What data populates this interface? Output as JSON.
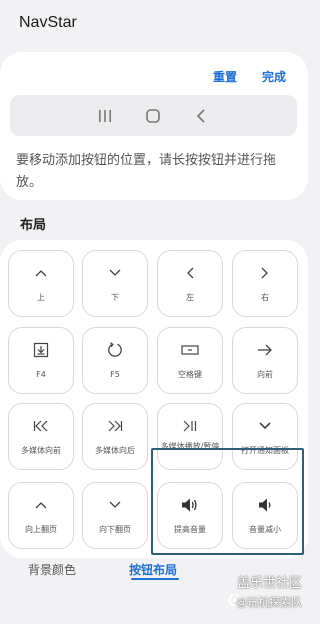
{
  "app_title": "NavStar",
  "header_actions": {
    "reset_label": "重置",
    "done_label": "完成"
  },
  "nav_preview": {
    "buttons": [
      "recents-icon",
      "home-icon",
      "back-icon"
    ]
  },
  "hint_text": "要移动添加按钮的位置，请长按按钮并进行拖放。",
  "section_title": "布局",
  "tiles": [
    {
      "label": "上",
      "icon": "chevron-up-icon"
    },
    {
      "label": "下",
      "icon": "chevron-down-icon"
    },
    {
      "label": "左",
      "icon": "chevron-left-icon"
    },
    {
      "label": "右",
      "icon": "chevron-right-icon"
    },
    {
      "label": "F4",
      "icon": "download-box-icon"
    },
    {
      "label": "F5",
      "icon": "refresh-icon"
    },
    {
      "label": "空格键",
      "icon": "space-key-icon"
    },
    {
      "label": "向前",
      "icon": "arrow-right-icon"
    },
    {
      "label": "多媒体向前",
      "icon": "skip-back-icon"
    },
    {
      "label": "多媒体向后",
      "icon": "skip-forward-icon"
    },
    {
      "label": "多媒体播放/暂停",
      "icon": "play-pause-icon"
    },
    {
      "label": "打开通知面板",
      "icon": "chevron-down-icon"
    },
    {
      "label": "向上翻页",
      "icon": "chevron-up-icon"
    },
    {
      "label": "向下翻页",
      "icon": "chevron-down-icon"
    },
    {
      "label": "提高音量",
      "icon": "volume-up-icon"
    },
    {
      "label": "音量减小",
      "icon": "volume-down-icon"
    }
  ],
  "bottom_tabs": {
    "background_color_label": "背景颜色",
    "button_layout_label": "按钮布局"
  },
  "watermark": {
    "line1": "盖乐世社区",
    "line2": "@玩机探索队"
  },
  "colors": {
    "accent": "#1c6fd6",
    "highlight_border": "#2e5f78",
    "page_bg": "#f2f2f4"
  }
}
